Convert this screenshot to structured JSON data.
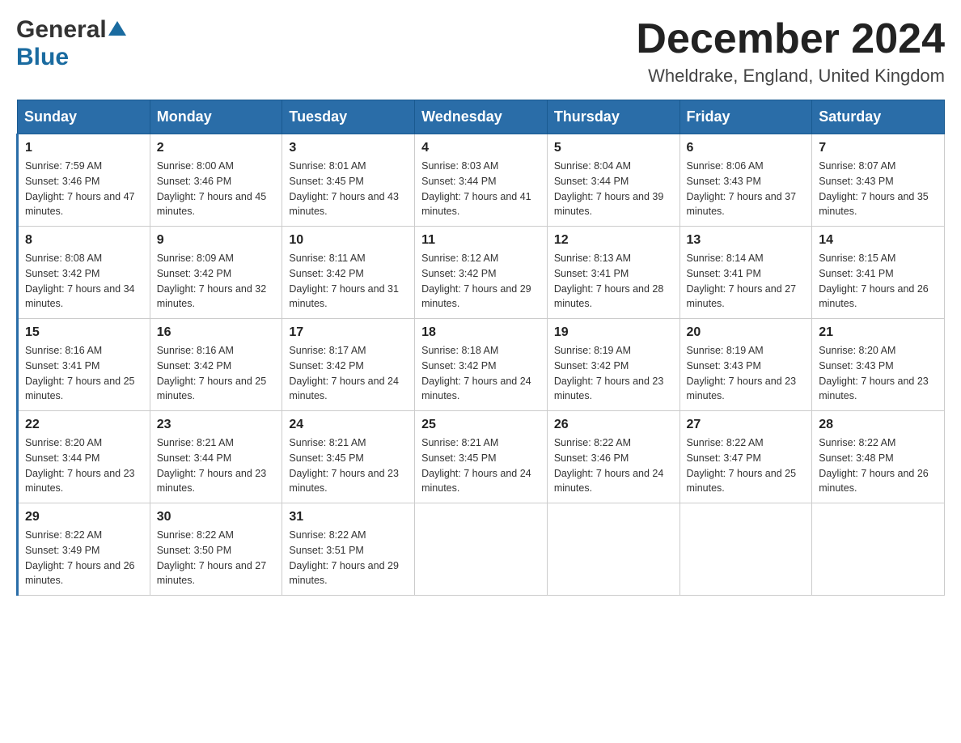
{
  "header": {
    "logo_general": "General",
    "logo_blue": "Blue",
    "title": "December 2024",
    "subtitle": "Wheldrake, England, United Kingdom"
  },
  "columns": [
    "Sunday",
    "Monday",
    "Tuesday",
    "Wednesday",
    "Thursday",
    "Friday",
    "Saturday"
  ],
  "weeks": [
    [
      {
        "day": "1",
        "sunrise": "7:59 AM",
        "sunset": "3:46 PM",
        "daylight": "7 hours and 47 minutes."
      },
      {
        "day": "2",
        "sunrise": "8:00 AM",
        "sunset": "3:46 PM",
        "daylight": "7 hours and 45 minutes."
      },
      {
        "day": "3",
        "sunrise": "8:01 AM",
        "sunset": "3:45 PM",
        "daylight": "7 hours and 43 minutes."
      },
      {
        "day": "4",
        "sunrise": "8:03 AM",
        "sunset": "3:44 PM",
        "daylight": "7 hours and 41 minutes."
      },
      {
        "day": "5",
        "sunrise": "8:04 AM",
        "sunset": "3:44 PM",
        "daylight": "7 hours and 39 minutes."
      },
      {
        "day": "6",
        "sunrise": "8:06 AM",
        "sunset": "3:43 PM",
        "daylight": "7 hours and 37 minutes."
      },
      {
        "day": "7",
        "sunrise": "8:07 AM",
        "sunset": "3:43 PM",
        "daylight": "7 hours and 35 minutes."
      }
    ],
    [
      {
        "day": "8",
        "sunrise": "8:08 AM",
        "sunset": "3:42 PM",
        "daylight": "7 hours and 34 minutes."
      },
      {
        "day": "9",
        "sunrise": "8:09 AM",
        "sunset": "3:42 PM",
        "daylight": "7 hours and 32 minutes."
      },
      {
        "day": "10",
        "sunrise": "8:11 AM",
        "sunset": "3:42 PM",
        "daylight": "7 hours and 31 minutes."
      },
      {
        "day": "11",
        "sunrise": "8:12 AM",
        "sunset": "3:42 PM",
        "daylight": "7 hours and 29 minutes."
      },
      {
        "day": "12",
        "sunrise": "8:13 AM",
        "sunset": "3:41 PM",
        "daylight": "7 hours and 28 minutes."
      },
      {
        "day": "13",
        "sunrise": "8:14 AM",
        "sunset": "3:41 PM",
        "daylight": "7 hours and 27 minutes."
      },
      {
        "day": "14",
        "sunrise": "8:15 AM",
        "sunset": "3:41 PM",
        "daylight": "7 hours and 26 minutes."
      }
    ],
    [
      {
        "day": "15",
        "sunrise": "8:16 AM",
        "sunset": "3:41 PM",
        "daylight": "7 hours and 25 minutes."
      },
      {
        "day": "16",
        "sunrise": "8:16 AM",
        "sunset": "3:42 PM",
        "daylight": "7 hours and 25 minutes."
      },
      {
        "day": "17",
        "sunrise": "8:17 AM",
        "sunset": "3:42 PM",
        "daylight": "7 hours and 24 minutes."
      },
      {
        "day": "18",
        "sunrise": "8:18 AM",
        "sunset": "3:42 PM",
        "daylight": "7 hours and 24 minutes."
      },
      {
        "day": "19",
        "sunrise": "8:19 AM",
        "sunset": "3:42 PM",
        "daylight": "7 hours and 23 minutes."
      },
      {
        "day": "20",
        "sunrise": "8:19 AM",
        "sunset": "3:43 PM",
        "daylight": "7 hours and 23 minutes."
      },
      {
        "day": "21",
        "sunrise": "8:20 AM",
        "sunset": "3:43 PM",
        "daylight": "7 hours and 23 minutes."
      }
    ],
    [
      {
        "day": "22",
        "sunrise": "8:20 AM",
        "sunset": "3:44 PM",
        "daylight": "7 hours and 23 minutes."
      },
      {
        "day": "23",
        "sunrise": "8:21 AM",
        "sunset": "3:44 PM",
        "daylight": "7 hours and 23 minutes."
      },
      {
        "day": "24",
        "sunrise": "8:21 AM",
        "sunset": "3:45 PM",
        "daylight": "7 hours and 23 minutes."
      },
      {
        "day": "25",
        "sunrise": "8:21 AM",
        "sunset": "3:45 PM",
        "daylight": "7 hours and 24 minutes."
      },
      {
        "day": "26",
        "sunrise": "8:22 AM",
        "sunset": "3:46 PM",
        "daylight": "7 hours and 24 minutes."
      },
      {
        "day": "27",
        "sunrise": "8:22 AM",
        "sunset": "3:47 PM",
        "daylight": "7 hours and 25 minutes."
      },
      {
        "day": "28",
        "sunrise": "8:22 AM",
        "sunset": "3:48 PM",
        "daylight": "7 hours and 26 minutes."
      }
    ],
    [
      {
        "day": "29",
        "sunrise": "8:22 AM",
        "sunset": "3:49 PM",
        "daylight": "7 hours and 26 minutes."
      },
      {
        "day": "30",
        "sunrise": "8:22 AM",
        "sunset": "3:50 PM",
        "daylight": "7 hours and 27 minutes."
      },
      {
        "day": "31",
        "sunrise": "8:22 AM",
        "sunset": "3:51 PM",
        "daylight": "7 hours and 29 minutes."
      },
      null,
      null,
      null,
      null
    ]
  ]
}
